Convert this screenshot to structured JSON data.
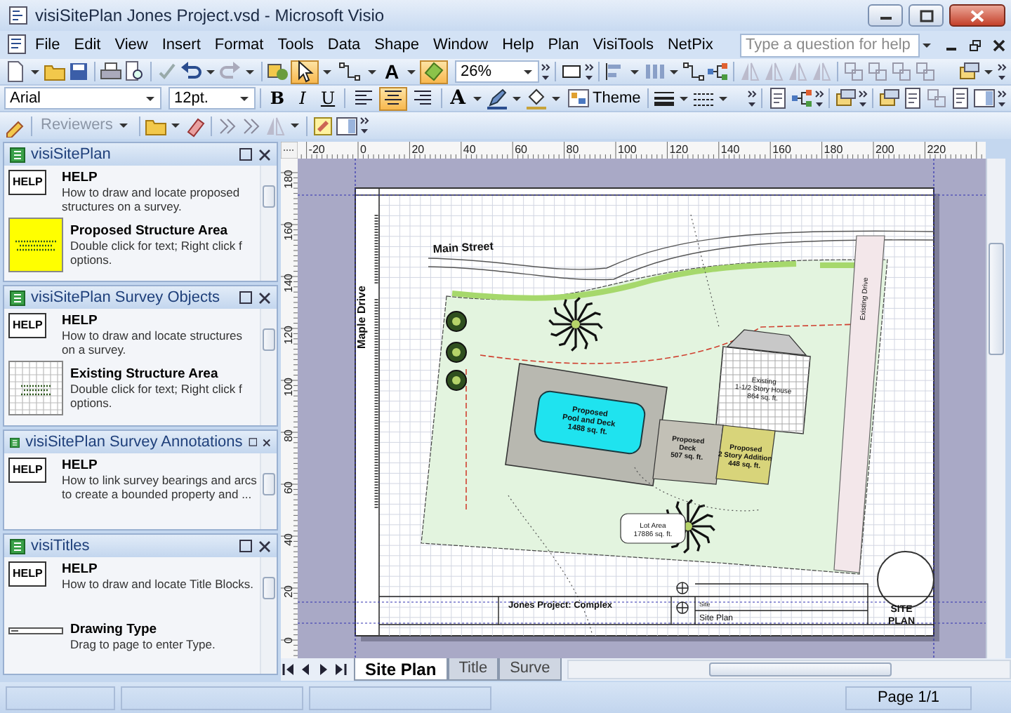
{
  "window": {
    "title": "visiSitePlan Jones Project.vsd - Microsoft Visio"
  },
  "menu": {
    "items": [
      "File",
      "Edit",
      "View",
      "Insert",
      "Format",
      "Tools",
      "Data",
      "Shape",
      "Window",
      "Help",
      "Plan",
      "VisiTools",
      "NetPix"
    ],
    "help_search": {
      "placeholder": "Type a question for help"
    }
  },
  "toolbar_standard": {
    "tools": [
      {
        "kind": "pointer",
        "selected": true
      },
      {
        "kind": "connector",
        "selected": false
      },
      {
        "kind": "text",
        "label": "A",
        "selected": false
      },
      {
        "kind": "stamp",
        "selected": true
      }
    ],
    "zoom": "26%"
  },
  "toolbar_formatting": {
    "font": "Arial",
    "font_size": "12pt.",
    "styles": [
      "B",
      "I",
      "U"
    ],
    "alignment": [
      {
        "kind": "left",
        "selected": false
      },
      {
        "kind": "center",
        "selected": true
      },
      {
        "kind": "right",
        "selected": false
      }
    ],
    "font_color": "A",
    "theme": "Theme"
  },
  "toolbar_reviewing": {
    "reviewers": {
      "label": "Reviewers",
      "disabled": true
    }
  },
  "stencils": [
    {
      "title": "visiSitePlan",
      "items": [
        {
          "kind": "help",
          "icon_label": "HELP",
          "title": "HELP",
          "description": [
            "How to draw and locate proposed",
            "structures on a survey."
          ]
        },
        {
          "kind": "proposed",
          "title": "Proposed Structure Area",
          "description": [
            "Double click for text; Right click f",
            "options."
          ]
        }
      ]
    },
    {
      "title": "visiSitePlan Survey Objects",
      "items": [
        {
          "kind": "help",
          "icon_label": "HELP",
          "title": "HELP",
          "description": [
            "How to draw and locate structures",
            "on a survey."
          ]
        },
        {
          "kind": "existing",
          "title": "Existing Structure Area",
          "description": [
            "Double click for text; Right click f",
            "options."
          ]
        }
      ]
    },
    {
      "title": "visiSitePlan Survey Annotations",
      "items": [
        {
          "kind": "help",
          "icon_label": "HELP",
          "title": "HELP",
          "description": [
            "How to link survey bearings and arcs",
            "to create a bounded property and ..."
          ]
        }
      ]
    },
    {
      "title": "visiTitles",
      "items": [
        {
          "kind": "help",
          "icon_label": "HELP",
          "title": "HELP",
          "description": [
            "How to draw and locate Title Blocks."
          ]
        },
        {
          "kind": "title-field",
          "title": "Drawing Type",
          "description": [
            "Drag to page to enter Type."
          ]
        }
      ]
    }
  ],
  "rulers": {
    "horizontal": [
      "-20",
      "0",
      "20",
      "40",
      "60",
      "80",
      "100",
      "120",
      "140",
      "160",
      "180",
      "200",
      "220"
    ],
    "vertical": [
      "180",
      "160",
      "140",
      "120",
      "100",
      "80",
      "60",
      "40",
      "20",
      "0"
    ]
  },
  "site_plan": {
    "labels": [
      {
        "lines": [
          "Main Street"
        ]
      },
      {
        "lines": [
          "Maple Drive"
        ]
      },
      {
        "lines": [
          "Existing Drive"
        ]
      },
      {
        "lines": [
          "Proposed",
          "Pool and Deck",
          "1488 sq. ft."
        ]
      },
      {
        "lines": [
          "Proposed",
          "Deck",
          "507 sq. ft."
        ]
      },
      {
        "lines": [
          "Proposed",
          "2 Story Addition",
          "448 sq. ft."
        ]
      },
      {
        "lines": [
          "Existing",
          "1-1/2 Story House",
          "864 sq. ft."
        ]
      },
      {
        "lines": [
          "Lot Area",
          "17886 sq. ft."
        ]
      }
    ],
    "title_block": {
      "project": "Jones Project: Complex",
      "field_label": "Site",
      "drawing": "Site Plan",
      "sheet_title": [
        "SITE",
        "PLAN"
      ]
    }
  },
  "page_tabs": [
    {
      "label": "Site Plan",
      "selected": true
    },
    {
      "label": "Title",
      "selected": false
    },
    {
      "label": "Surve",
      "selected": false
    }
  ],
  "status_bar": {
    "page": "Page 1/1"
  }
}
